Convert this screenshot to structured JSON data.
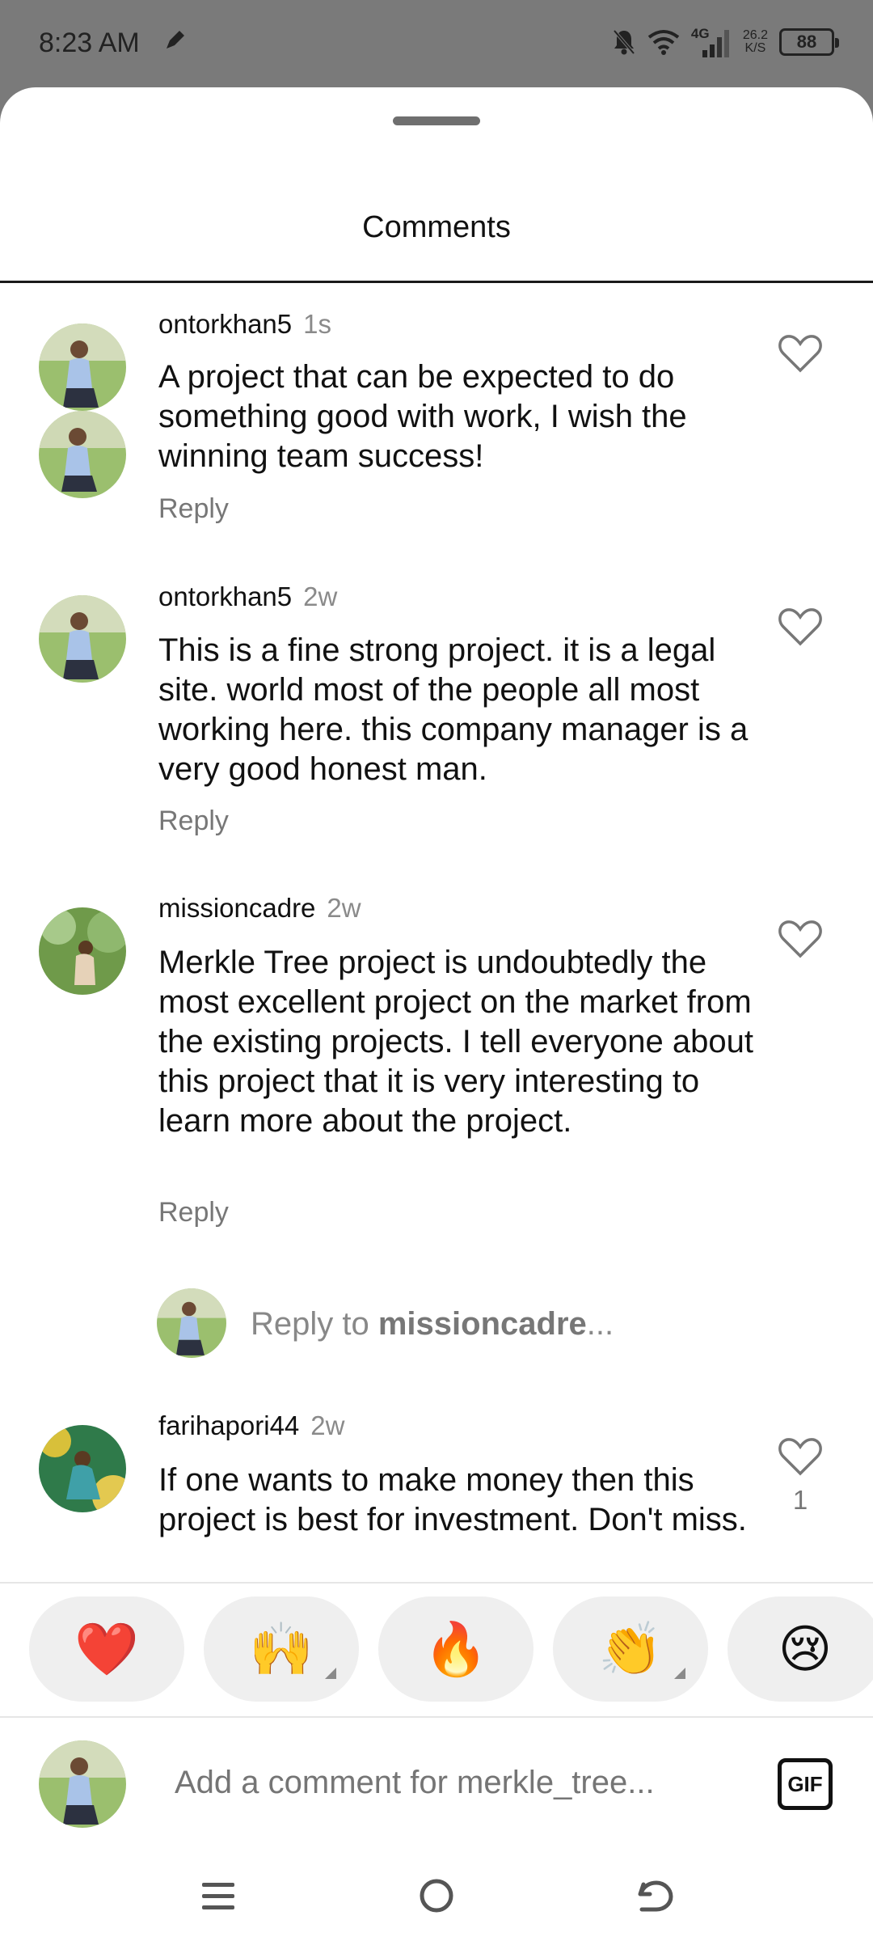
{
  "status_bar": {
    "time": "8:23 AM",
    "signal_label": "4G",
    "net_speed_value": "26.2",
    "net_speed_unit": "K/S",
    "battery": "88"
  },
  "sheet": {
    "title": "Comments"
  },
  "comments": [
    {
      "username": "ontorkhan5",
      "time": "1s",
      "text": "A project that can be expected to do something good with work, I wish the winning team success!",
      "reply_label": "Reply"
    },
    {
      "username": "ontorkhan5",
      "time": "2w",
      "text": "This is a fine strong project. it is a legal site. world most of the people all most working here. this company manager is a very good honest man.",
      "reply_label": "Reply"
    },
    {
      "username": "missioncadre",
      "time": "2w",
      "text": "Merkle Tree project is undoubtedly the most excellent project on the market from the existing projects. I tell everyone about this project that it is very interesting to learn more about the project.",
      "reply_label": "Reply"
    },
    {
      "username": "farihapori44",
      "time": "2w",
      "text": "If one wants to make money then this project is best for investment. Don't miss.",
      "like_count": "1"
    }
  ],
  "reply_prompt": {
    "prefix": "Reply to ",
    "username": "missioncadre",
    "suffix": "..."
  },
  "reactions": [
    {
      "emoji": "❤️",
      "name": "heart"
    },
    {
      "emoji": "🙌",
      "name": "raising-hands"
    },
    {
      "emoji": "🔥",
      "name": "fire"
    },
    {
      "emoji": "👏",
      "name": "clapping-hands"
    },
    {
      "emoji": "😢",
      "name": "crying-face"
    }
  ],
  "composer": {
    "placeholder": "Add a comment for merkle_tree...",
    "gif_label": "GIF"
  },
  "icons": {
    "like": "heart-outline-icon",
    "nav_menu": "menu-icon",
    "nav_home": "home-circle-icon",
    "nav_back": "back-icon"
  }
}
